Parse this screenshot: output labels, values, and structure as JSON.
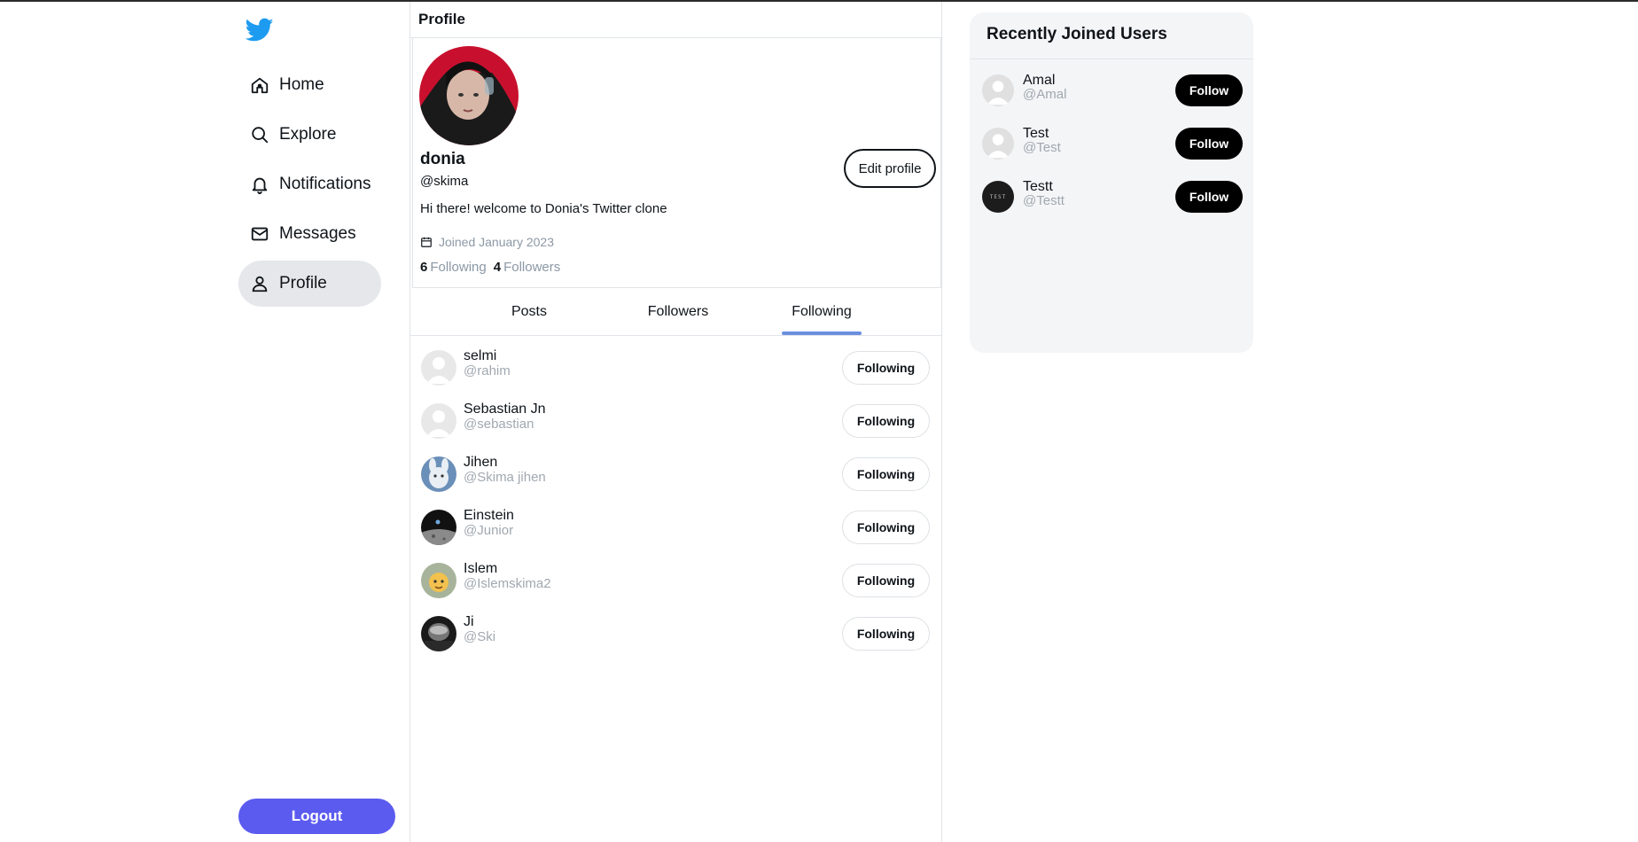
{
  "nav": {
    "items": [
      {
        "label": "Home"
      },
      {
        "label": "Explore"
      },
      {
        "label": "Notifications"
      },
      {
        "label": "Messages"
      },
      {
        "label": "Profile"
      }
    ],
    "logout_label": "Logout",
    "brand_color": "#1d9bf0",
    "logout_color": "#5b5bf0"
  },
  "main": {
    "title": "Profile",
    "profile": {
      "display_name": "donia",
      "handle": "@skima",
      "bio": "Hi there! welcome to Donia's Twitter clone",
      "joined": "Joined January 2023",
      "following_count": "6",
      "following_label": "Following",
      "followers_count": "4",
      "followers_label": "Followers",
      "edit_label": "Edit profile"
    },
    "tabs": [
      {
        "label": "Posts"
      },
      {
        "label": "Followers"
      },
      {
        "label": "Following"
      }
    ],
    "active_tab": "Following",
    "following_list": [
      {
        "name": "selmi",
        "handle": "@rahim",
        "button": "Following",
        "avatar": "default"
      },
      {
        "name": "Sebastian Jn",
        "handle": "@sebastian",
        "button": "Following",
        "avatar": "default"
      },
      {
        "name": "Jihen",
        "handle": "@Skima jihen",
        "button": "Following",
        "avatar": "bunny"
      },
      {
        "name": "Einstein",
        "handle": "@Junior",
        "button": "Following",
        "avatar": "dark-moon"
      },
      {
        "name": "Islem",
        "handle": "@Islemskima2",
        "button": "Following",
        "avatar": "yellow-character"
      },
      {
        "name": "Ji",
        "handle": "@Ski",
        "button": "Following",
        "avatar": "dark-round"
      }
    ]
  },
  "right_panel": {
    "title": "Recently Joined Users",
    "users": [
      {
        "name": "Amal",
        "handle": "@Amal",
        "button": "Follow",
        "avatar": "default"
      },
      {
        "name": "Test",
        "handle": "@Test",
        "button": "Follow",
        "avatar": "default"
      },
      {
        "name": "Testt",
        "handle": "@Testt",
        "button": "Follow",
        "avatar": "test-dark",
        "avatar_text": "TEST"
      }
    ]
  }
}
